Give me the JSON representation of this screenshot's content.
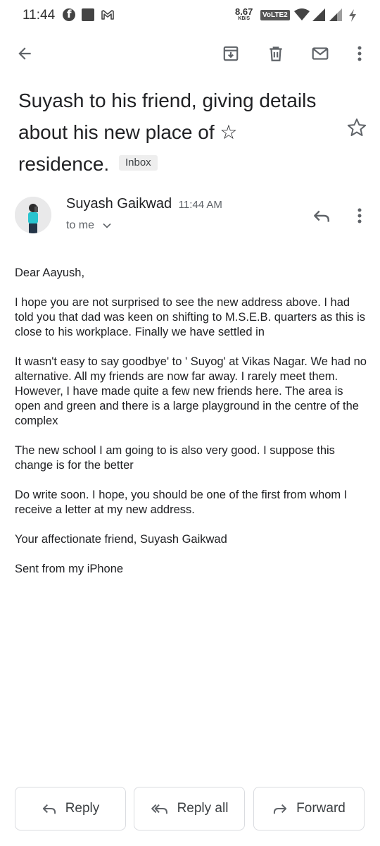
{
  "status_bar": {
    "time": "11:44",
    "speed_value": "8.67",
    "speed_unit": "KB/S",
    "network_badge": "VoLTE2",
    "icons": [
      "facebook-icon",
      "square-icon",
      "gmail-icon",
      "wifi-icon",
      "signal-icon",
      "signal-icon",
      "charging-icon"
    ]
  },
  "toolbar": {
    "back_icon": "arrow-back-icon",
    "archive_icon": "archive-icon",
    "delete_icon": "trash-icon",
    "mail_icon": "mark-unread-icon",
    "more_icon": "more-vert-icon"
  },
  "subject": {
    "text": "Suyash to his friend, giving details about his new place of ☆ residence.",
    "label": "Inbox"
  },
  "message": {
    "sender": "Suyash Gaikwad",
    "time": "11:44 AM",
    "recipient": "to me",
    "body": [
      "Dear Aayush,",
      "I hope you are not surprised to see the new address above. I had told you that dad was keen on shifting to M.S.E.B. quarters as this is close to his workplace. Finally we have settled in",
      "It wasn't easy to say goodbye' to ' Suyog' at Vikas Nagar. We had no alternative. All my friends are now far away. I rarely meet them. However, I have made quite a few new friends here. The area is open and green and there is a large playground in the centre of the complex",
      "The new school I am going to is also very good. I suppose this change is for the better",
      "Do write soon. I hope, you should be one of the first from whom I receive a letter at my new address.",
      "Your affectionate friend, Suyash Gaikwad",
      "Sent from my iPhone"
    ]
  },
  "actions": {
    "reply": "Reply",
    "reply_all": "Reply all",
    "forward": "Forward"
  },
  "colors": {
    "text_primary": "#202124",
    "text_secondary": "#5f6368",
    "icon": "#5f6368",
    "badge_bg": "#eeeeee",
    "button_border": "#dadce0",
    "avatar_shirt": "#29c4cf"
  }
}
